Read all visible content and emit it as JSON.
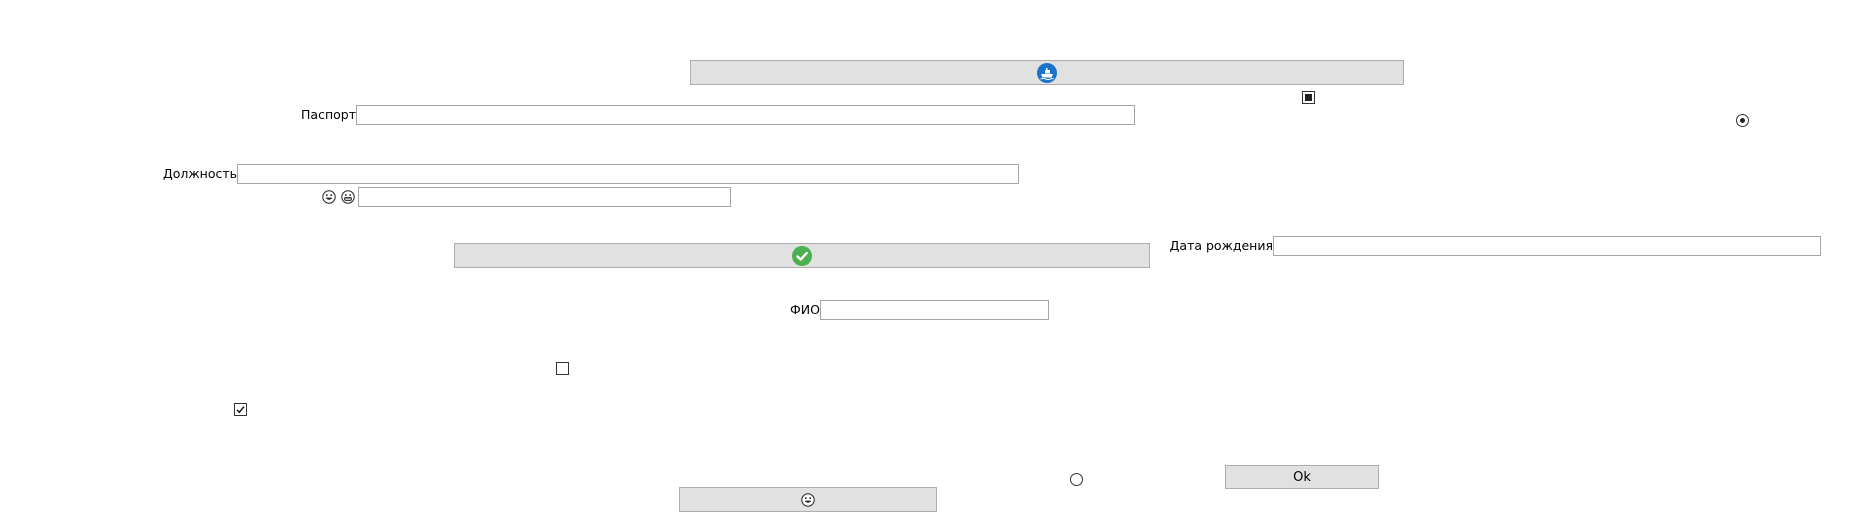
{
  "buttons": {
    "ship_button_icon": "ship-icon",
    "check_button_icon": "check-circle-icon",
    "emoji_button_icon": "grinning-face-icon",
    "ok_label": "Ok"
  },
  "fields": {
    "passport": {
      "label": "Паспорт",
      "value": ""
    },
    "position": {
      "label": "Должность",
      "value": ""
    },
    "emoji_field": {
      "value": ""
    },
    "birth_date": {
      "label": "Дата рождения",
      "value": ""
    },
    "full_name": {
      "label": "ФИО",
      "value": ""
    }
  },
  "controls": {
    "tristate_checkbox": {
      "state": "indeterminate"
    },
    "radio_top_right": {
      "checked": true
    },
    "radio_bottom": {
      "checked": false
    },
    "checkbox_unchecked": {
      "checked": false
    },
    "checkbox_checked": {
      "checked": true
    }
  },
  "colors": {
    "button_bg": "#e1e1e1",
    "ship_icon_blue": "#1a73c8",
    "check_icon_green": "#4caf50"
  }
}
